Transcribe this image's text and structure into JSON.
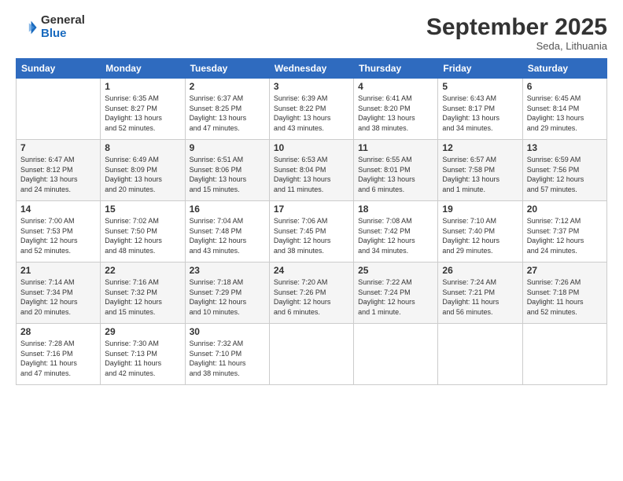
{
  "logo": {
    "general": "General",
    "blue": "Blue"
  },
  "header": {
    "month": "September 2025",
    "location": "Seda, Lithuania"
  },
  "weekdays": [
    "Sunday",
    "Monday",
    "Tuesday",
    "Wednesday",
    "Thursday",
    "Friday",
    "Saturday"
  ],
  "weeks": [
    [
      {
        "day": "",
        "info": ""
      },
      {
        "day": "1",
        "info": "Sunrise: 6:35 AM\nSunset: 8:27 PM\nDaylight: 13 hours\nand 52 minutes."
      },
      {
        "day": "2",
        "info": "Sunrise: 6:37 AM\nSunset: 8:25 PM\nDaylight: 13 hours\nand 47 minutes."
      },
      {
        "day": "3",
        "info": "Sunrise: 6:39 AM\nSunset: 8:22 PM\nDaylight: 13 hours\nand 43 minutes."
      },
      {
        "day": "4",
        "info": "Sunrise: 6:41 AM\nSunset: 8:20 PM\nDaylight: 13 hours\nand 38 minutes."
      },
      {
        "day": "5",
        "info": "Sunrise: 6:43 AM\nSunset: 8:17 PM\nDaylight: 13 hours\nand 34 minutes."
      },
      {
        "day": "6",
        "info": "Sunrise: 6:45 AM\nSunset: 8:14 PM\nDaylight: 13 hours\nand 29 minutes."
      }
    ],
    [
      {
        "day": "7",
        "info": "Sunrise: 6:47 AM\nSunset: 8:12 PM\nDaylight: 13 hours\nand 24 minutes."
      },
      {
        "day": "8",
        "info": "Sunrise: 6:49 AM\nSunset: 8:09 PM\nDaylight: 13 hours\nand 20 minutes."
      },
      {
        "day": "9",
        "info": "Sunrise: 6:51 AM\nSunset: 8:06 PM\nDaylight: 13 hours\nand 15 minutes."
      },
      {
        "day": "10",
        "info": "Sunrise: 6:53 AM\nSunset: 8:04 PM\nDaylight: 13 hours\nand 11 minutes."
      },
      {
        "day": "11",
        "info": "Sunrise: 6:55 AM\nSunset: 8:01 PM\nDaylight: 13 hours\nand 6 minutes."
      },
      {
        "day": "12",
        "info": "Sunrise: 6:57 AM\nSunset: 7:58 PM\nDaylight: 13 hours\nand 1 minute."
      },
      {
        "day": "13",
        "info": "Sunrise: 6:59 AM\nSunset: 7:56 PM\nDaylight: 12 hours\nand 57 minutes."
      }
    ],
    [
      {
        "day": "14",
        "info": "Sunrise: 7:00 AM\nSunset: 7:53 PM\nDaylight: 12 hours\nand 52 minutes."
      },
      {
        "day": "15",
        "info": "Sunrise: 7:02 AM\nSunset: 7:50 PM\nDaylight: 12 hours\nand 48 minutes."
      },
      {
        "day": "16",
        "info": "Sunrise: 7:04 AM\nSunset: 7:48 PM\nDaylight: 12 hours\nand 43 minutes."
      },
      {
        "day": "17",
        "info": "Sunrise: 7:06 AM\nSunset: 7:45 PM\nDaylight: 12 hours\nand 38 minutes."
      },
      {
        "day": "18",
        "info": "Sunrise: 7:08 AM\nSunset: 7:42 PM\nDaylight: 12 hours\nand 34 minutes."
      },
      {
        "day": "19",
        "info": "Sunrise: 7:10 AM\nSunset: 7:40 PM\nDaylight: 12 hours\nand 29 minutes."
      },
      {
        "day": "20",
        "info": "Sunrise: 7:12 AM\nSunset: 7:37 PM\nDaylight: 12 hours\nand 24 minutes."
      }
    ],
    [
      {
        "day": "21",
        "info": "Sunrise: 7:14 AM\nSunset: 7:34 PM\nDaylight: 12 hours\nand 20 minutes."
      },
      {
        "day": "22",
        "info": "Sunrise: 7:16 AM\nSunset: 7:32 PM\nDaylight: 12 hours\nand 15 minutes."
      },
      {
        "day": "23",
        "info": "Sunrise: 7:18 AM\nSunset: 7:29 PM\nDaylight: 12 hours\nand 10 minutes."
      },
      {
        "day": "24",
        "info": "Sunrise: 7:20 AM\nSunset: 7:26 PM\nDaylight: 12 hours\nand 6 minutes."
      },
      {
        "day": "25",
        "info": "Sunrise: 7:22 AM\nSunset: 7:24 PM\nDaylight: 12 hours\nand 1 minute."
      },
      {
        "day": "26",
        "info": "Sunrise: 7:24 AM\nSunset: 7:21 PM\nDaylight: 11 hours\nand 56 minutes."
      },
      {
        "day": "27",
        "info": "Sunrise: 7:26 AM\nSunset: 7:18 PM\nDaylight: 11 hours\nand 52 minutes."
      }
    ],
    [
      {
        "day": "28",
        "info": "Sunrise: 7:28 AM\nSunset: 7:16 PM\nDaylight: 11 hours\nand 47 minutes."
      },
      {
        "day": "29",
        "info": "Sunrise: 7:30 AM\nSunset: 7:13 PM\nDaylight: 11 hours\nand 42 minutes."
      },
      {
        "day": "30",
        "info": "Sunrise: 7:32 AM\nSunset: 7:10 PM\nDaylight: 11 hours\nand 38 minutes."
      },
      {
        "day": "",
        "info": ""
      },
      {
        "day": "",
        "info": ""
      },
      {
        "day": "",
        "info": ""
      },
      {
        "day": "",
        "info": ""
      }
    ]
  ]
}
